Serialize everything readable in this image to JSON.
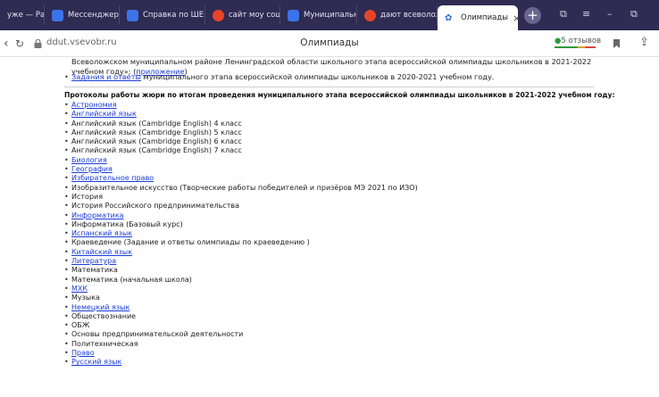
{
  "browser": {
    "tabs": [
      {
        "label": "уже — Ра",
        "color": "#3b3663"
      },
      {
        "label": "Мессенджер",
        "color": "#3b73e8"
      },
      {
        "label": "Справка по ШЕ",
        "color": "#3b73e8"
      },
      {
        "label": "сайт моу сош 4",
        "color": "#e8442a"
      },
      {
        "label": "Муниципальнос",
        "color": "#3b73e8"
      },
      {
        "label": "дают всеволож",
        "color": "#e8442a"
      },
      {
        "label": "Олимпиады",
        "color": "#2d6fe0",
        "active": true
      }
    ],
    "url": "ddut.vsevobr.ru",
    "page_title": "Олимпиады",
    "reviews": "5 отзывов",
    "new_tab": "+"
  },
  "content": {
    "intro_text": "Всеволожском муниципальном районе Ленинградской области школьного этапа всероссийской олимпиады школьников в 2021-2022 учебном году»; (",
    "intro_link": "приложение",
    "intro_tail": ")",
    "tasks_link": "Задания и ответы",
    "tasks_text": " муниципального этапа всероссийской олимпиады школьников в 2020-2021 учебном году.",
    "heading": "Протоколы работы жюри по итогам проведения муниципального этапа всероссийской олимпиады школьников в 2021-2022 учебном году:",
    "subjects": [
      {
        "label": "Астрономия",
        "link": true
      },
      {
        "label": "Английский язык",
        "link": true
      },
      {
        "label": "Английский язык (Cambridge English) 4 класс",
        "link": false
      },
      {
        "label": "Английский язык (Cambridge English) 5 класс",
        "link": false
      },
      {
        "label": "Английский язык (Cambridge English) 6 класс",
        "link": false
      },
      {
        "label": "Английский язык (Cambridge English) 7 класс",
        "link": false
      },
      {
        "label": "Биология",
        "link": true
      },
      {
        "label": "География",
        "link": true
      },
      {
        "label": "Избирательное право",
        "link": true
      },
      {
        "label": "Изобразительное искусство (Творческие работы победителей и призёров МЭ 2021 по ИЗО)",
        "link": false
      },
      {
        "label": "История",
        "link": false
      },
      {
        "label": "История Российского предпринимательства",
        "link": false
      },
      {
        "label": "Информатика",
        "link": true
      },
      {
        "label": "Информатика (Базовый курс)",
        "link": false
      },
      {
        "label": "Испанский язык",
        "link": true
      },
      {
        "label": "Краеведение (Задание и ответы олимпиады по краеведению )",
        "link": false
      },
      {
        "label": "Китайский язык",
        "link": true
      },
      {
        "label": "Литература",
        "link": true
      },
      {
        "label": "Математика",
        "link": false
      },
      {
        "label": "Математика (начальная школа)",
        "link": false
      },
      {
        "label": "МХК",
        "link": true
      },
      {
        "label": "Музыка",
        "link": false
      },
      {
        "label": "Немецкий язык",
        "link": true
      },
      {
        "label": "Обществознание",
        "link": false
      },
      {
        "label": "ОБЖ",
        "link": false
      },
      {
        "label": "Основы предпринимательской деятельности",
        "link": false
      },
      {
        "label": "Политехническая",
        "link": false
      },
      {
        "label": "Право",
        "link": true
      },
      {
        "label": "Русский язык",
        "link": true
      }
    ]
  }
}
